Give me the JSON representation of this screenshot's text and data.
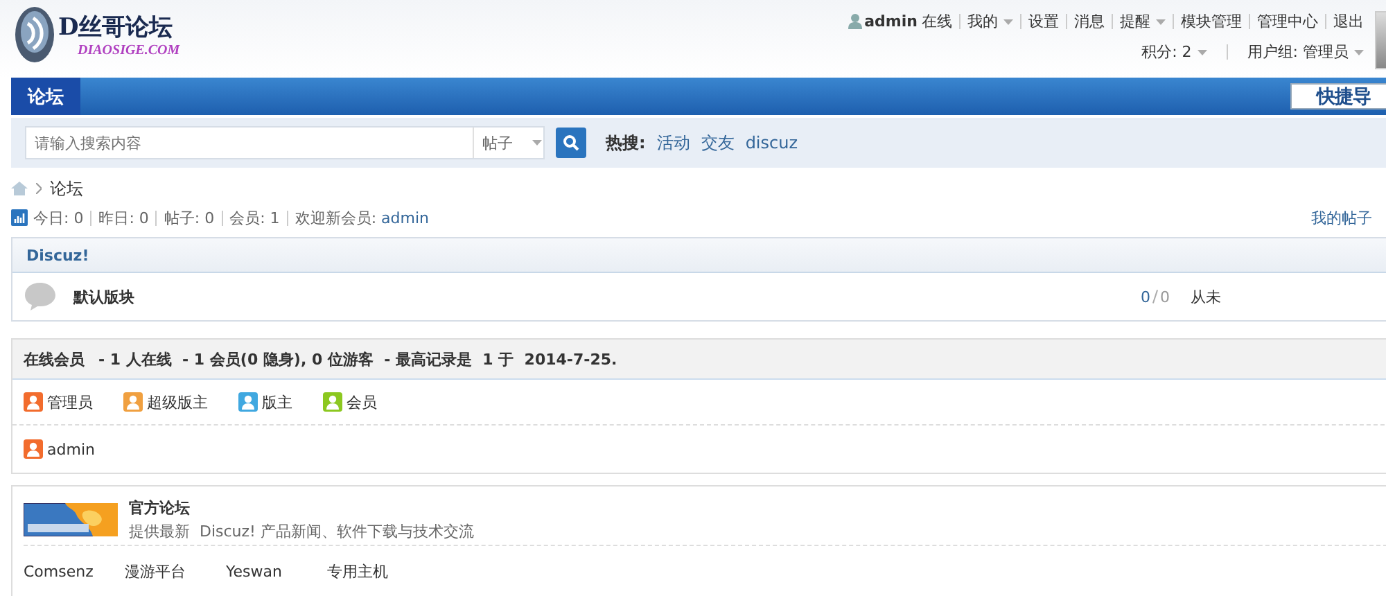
{
  "logo": {
    "title": "D丝哥论坛",
    "subtitle": "DIAOSIGE.COM"
  },
  "user_menu": {
    "username": "admin",
    "status": "在线",
    "items": [
      {
        "label": "我的",
        "dropdown": true
      },
      {
        "label": "设置",
        "dropdown": false
      },
      {
        "label": "消息",
        "dropdown": false
      },
      {
        "label": "提醒",
        "dropdown": true
      },
      {
        "label": "模块管理",
        "dropdown": false
      },
      {
        "label": "管理中心",
        "dropdown": false
      },
      {
        "label": "退出",
        "dropdown": false
      }
    ]
  },
  "user_stats": [
    {
      "label": "积分: 2",
      "dropdown": true
    },
    {
      "label": "用户组: 管理员",
      "dropdown": true
    }
  ],
  "nav": {
    "tabs": [
      {
        "label": "论坛",
        "selected": true
      }
    ],
    "quick_nav": "快捷导"
  },
  "search": {
    "placeholder": "请输入搜索内容",
    "type": "帖子",
    "hot_label": "热搜:",
    "hot_links": [
      "活动",
      "交友",
      "discuz"
    ]
  },
  "breadcrumb": [
    "论坛"
  ],
  "stats": {
    "items": [
      "今日: 0",
      "昨日: 0",
      "帖子: 0",
      "会员: 1"
    ],
    "welcome": "欢迎新会员:",
    "new_member": "admin",
    "my_posts": "我的帖子"
  },
  "category": {
    "name": "Discuz!",
    "forums": [
      {
        "name": "默认版块",
        "threads": "0",
        "posts": "0",
        "last_post": "从未"
      }
    ]
  },
  "online": {
    "title": "在线会员",
    "summary": "- 1 人在线  - 1 会员(0 隐身), 0 位游客  - 最高记录是  1 于  2014-7-25.",
    "legend": [
      {
        "label": "管理员",
        "color": "#f26c2d"
      },
      {
        "label": "超级版主",
        "color": "#f0a040"
      },
      {
        "label": "版主",
        "color": "#40a8e0"
      },
      {
        "label": "会员",
        "color": "#8cc820"
      }
    ],
    "users": [
      {
        "name": "admin",
        "color": "#f26c2d"
      }
    ]
  },
  "links": {
    "name": "官方论坛",
    "description": "提供最新  Discuz! 产品新闻、软件下载与技术交流",
    "text_links": [
      "Comsenz",
      "漫游平台",
      "Yeswan",
      "专用主机"
    ]
  }
}
